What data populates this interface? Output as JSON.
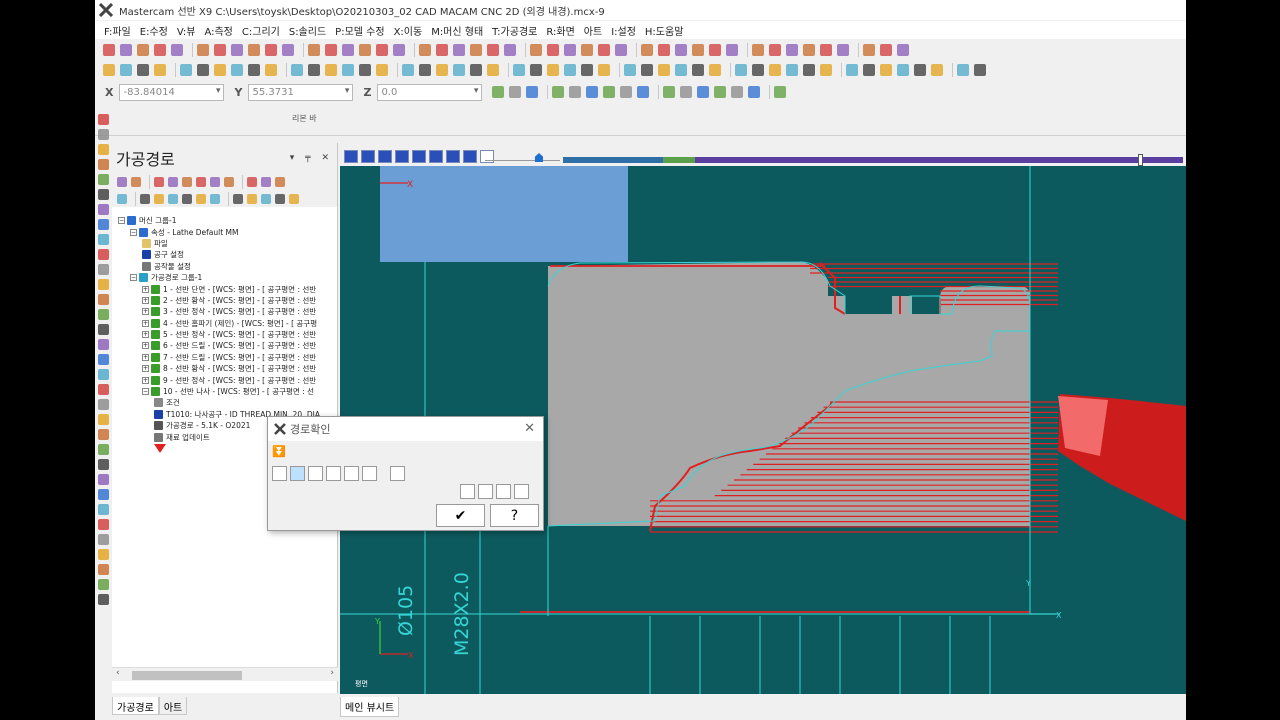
{
  "app": {
    "title": "Mastercam 선반 X9  C:\\Users\\toysk\\Desktop\\O20210303_02 CAD MACAM CNC 2D (외경 내경).mcx-9"
  },
  "menu": [
    "F:파일",
    "E:수정",
    "V:뷰",
    "A:측정",
    "C:그리기",
    "S:솔리드",
    "P:모델 수정",
    "X:이동",
    "M:머신 형태",
    "T:가공경로",
    "R:화면",
    "아트",
    "I:설정",
    "H:도움말"
  ],
  "coords": {
    "x_label": "X",
    "x_value": "-83.84014",
    "y_label": "Y",
    "y_value": "55.3731",
    "z_label": "Z",
    "z_value": "0.0"
  },
  "ribbon_label": "리본 바",
  "panel": {
    "title": "가공경로",
    "controls": "▾ ╤ ✕",
    "tree": [
      {
        "indent": 0,
        "toggle": "−",
        "icon": "machine",
        "text": "머신 그룹-1"
      },
      {
        "indent": 1,
        "toggle": "−",
        "icon": "props",
        "text": "속성 - Lathe Default MM"
      },
      {
        "indent": 2,
        "toggle": "",
        "icon": "folder",
        "text": "파일"
      },
      {
        "indent": 2,
        "toggle": "",
        "icon": "tool",
        "text": "공구 설정"
      },
      {
        "indent": 2,
        "toggle": "",
        "icon": "stock",
        "text": "공작물 설정"
      },
      {
        "indent": 1,
        "toggle": "−",
        "icon": "group",
        "text": "가공경로 그룹-1"
      },
      {
        "indent": 2,
        "toggle": "+",
        "icon": "check",
        "text": "1 - 선반 단면 - [WCS: 평면] - [ 공구평면 : 선반"
      },
      {
        "indent": 2,
        "toggle": "+",
        "icon": "check",
        "text": "2 - 선반 황삭 - [WCS: 평면] - [ 공구평면 : 선반"
      },
      {
        "indent": 2,
        "toggle": "+",
        "icon": "check",
        "text": "3 - 선반 정삭 - [WCS: 평면] - [ 공구평면 : 선반"
      },
      {
        "indent": 2,
        "toggle": "+",
        "icon": "check",
        "text": "4 - 선반 홈파기 (제인) - [WCS: 평면] - [ 공구평"
      },
      {
        "indent": 2,
        "toggle": "+",
        "icon": "check",
        "text": "5 - 선반 정삭 - [WCS: 평면] - [ 공구평면 : 선반"
      },
      {
        "indent": 2,
        "toggle": "+",
        "icon": "check",
        "text": "6 - 선반 드릴 - [WCS: 평면] - [ 공구평면 : 선반"
      },
      {
        "indent": 2,
        "toggle": "+",
        "icon": "check",
        "text": "7 - 선반 드릴 - [WCS: 평면] - [ 공구평면 : 선반"
      },
      {
        "indent": 2,
        "toggle": "+",
        "icon": "check",
        "text": "8 - 선반 황삭 - [WCS: 평면] - [ 공구평면 : 선반"
      },
      {
        "indent": 2,
        "toggle": "+",
        "icon": "check",
        "text": "9 - 선반 정삭 - [WCS: 평면] - [ 공구평면 : 선반"
      },
      {
        "indent": 2,
        "toggle": "−",
        "icon": "check",
        "text": "10 - 선반 나사 - [WCS: 평면] - [ 공구평면 : 선"
      },
      {
        "indent": 3,
        "toggle": "",
        "icon": "cond",
        "text": "조건"
      },
      {
        "indent": 3,
        "toggle": "",
        "icon": "tool",
        "text": "T1010: 나사공구 - ID THREAD MIN. 20. DIA"
      },
      {
        "indent": 3,
        "toggle": "",
        "icon": "path",
        "text": "가공경로 - 5.1K - O2021"
      },
      {
        "indent": 3,
        "toggle": "",
        "icon": "stock",
        "text": "재료 업데이트"
      }
    ],
    "tabs": [
      "가공경로",
      "아트"
    ]
  },
  "viewport": {
    "tab": "메인 뷰시트",
    "view_label": "평면",
    "dim_diameter": "Ø105",
    "dim_thread": "M28X2.0",
    "axis_x": "X",
    "axis_y": "Y"
  },
  "dialog": {
    "title": "경로확인",
    "ok": "✔",
    "help": "?"
  },
  "colors": {
    "viewport_bg": "#0d5a5e",
    "stock_gray": "#a8a8a8",
    "toolpath_red": "#e02020",
    "cyan": "#35d6d6",
    "chuck_blue": "#6b9ed4"
  }
}
